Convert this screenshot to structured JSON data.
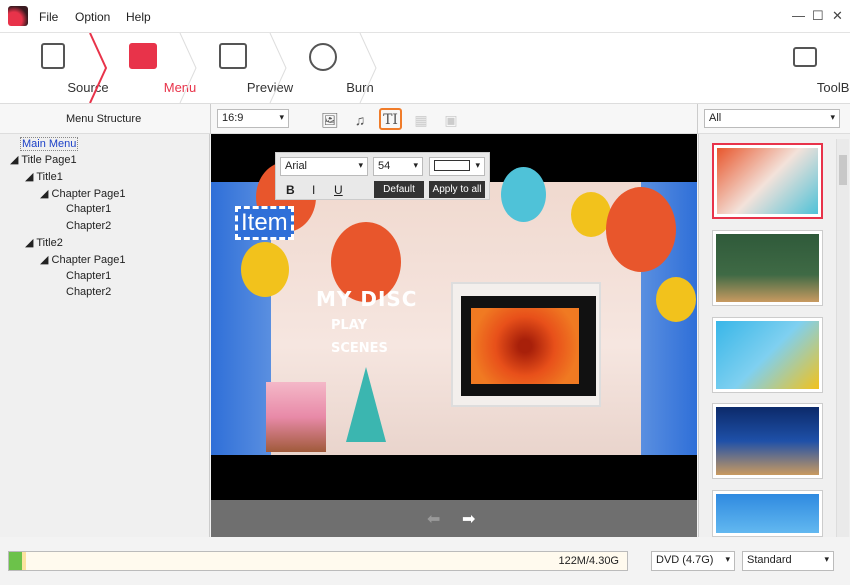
{
  "menubar": {
    "items": [
      "File",
      "Option",
      "Help"
    ]
  },
  "window": {
    "minimize": "—",
    "maximize": "☐",
    "close": "✕"
  },
  "steps": [
    {
      "label": "Source"
    },
    {
      "label": "Menu",
      "active": true
    },
    {
      "label": "Preview"
    },
    {
      "label": "Burn"
    }
  ],
  "toolbox": {
    "label": "ToolBox"
  },
  "toolbar": {
    "menu_structure": "Menu Structure",
    "aspect": "16:9",
    "filter": "All"
  },
  "tree": [
    "Main Menu",
    "Title Page1",
    "Title1",
    "Chapter Page1",
    "Chapter1",
    "Chapter2",
    "Title2",
    "Chapter Page1",
    "Chapter1",
    "Chapter2"
  ],
  "text_popup": {
    "font": "Arial",
    "size": "54",
    "bold": "B",
    "italic": "I",
    "underline": "U",
    "default": "Default",
    "apply_all": "Apply to all"
  },
  "scene": {
    "item_text": "Item",
    "title": "MY DISC",
    "play": "PLAY",
    "scenes": "SCENES"
  },
  "nav_arrows": {
    "prev": "⬅",
    "next": "➡"
  },
  "status": {
    "usage": "122M/4.30G",
    "usage_fraction": 0.028,
    "disc": "DVD (4.7G)",
    "quality": "Standard"
  },
  "colors": {
    "accent": "#e8334a",
    "highlight": "#f07c2a"
  }
}
